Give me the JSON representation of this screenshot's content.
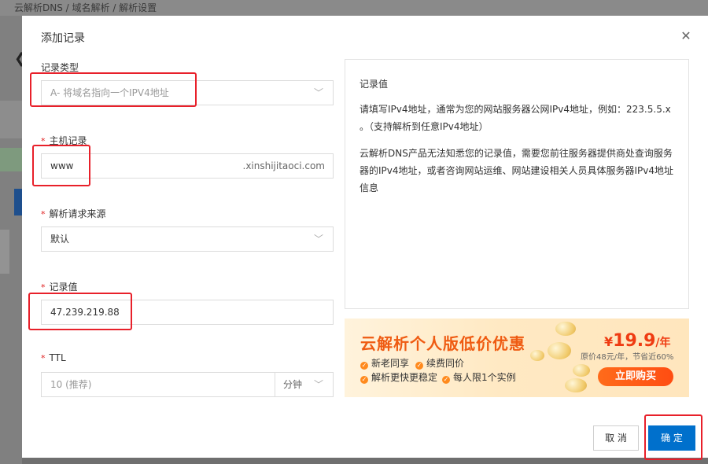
{
  "background": {
    "breadcrumb": "云解析DNS / 域名解析 / 解析设置"
  },
  "dialog": {
    "title": "添加记录",
    "close_icon": "close-icon"
  },
  "form": {
    "record_type": {
      "label": "记录类型",
      "value": "A- 将域名指向一个IPV4地址"
    },
    "host_record": {
      "label": "主机记录",
      "value": "www",
      "suffix": ".xinshijitaoci.com"
    },
    "source": {
      "label": "解析请求来源",
      "value": "默认"
    },
    "record_value": {
      "label": "记录值",
      "value": "47.239.219.88"
    },
    "ttl": {
      "label": "TTL",
      "value": "10 (推荐)",
      "unit": "分钟"
    }
  },
  "info": {
    "title": "记录值",
    "para1": "请填写IPv4地址，通常为您的网站服务器公网IPv4地址，例如：223.5.5.x 。（支持解析到任意IPv4地址）",
    "para2": "云解析DNS产品无法知悉您的记录值，需要您前往服务器提供商处查询服务器的IPv4地址，或者咨询网站运维、网站建设相关人员具体服务器IPv4地址信息"
  },
  "promo": {
    "title": "云解析个人版低价优惠",
    "features": [
      "新老同享",
      "续费同价",
      "解析更快更稳定",
      "每人限1个实例"
    ],
    "price_currency": "¥",
    "price_value": "19.9",
    "price_unit": "/年",
    "price_note": "原价48元/年，节省近60%",
    "buy_label": "立即购买"
  },
  "footer": {
    "cancel_label": "取 消",
    "ok_label": "确 定"
  },
  "colors": {
    "primary": "#0070cc",
    "highlight": "#e8202a",
    "promo_orange": "#ef5b12"
  }
}
